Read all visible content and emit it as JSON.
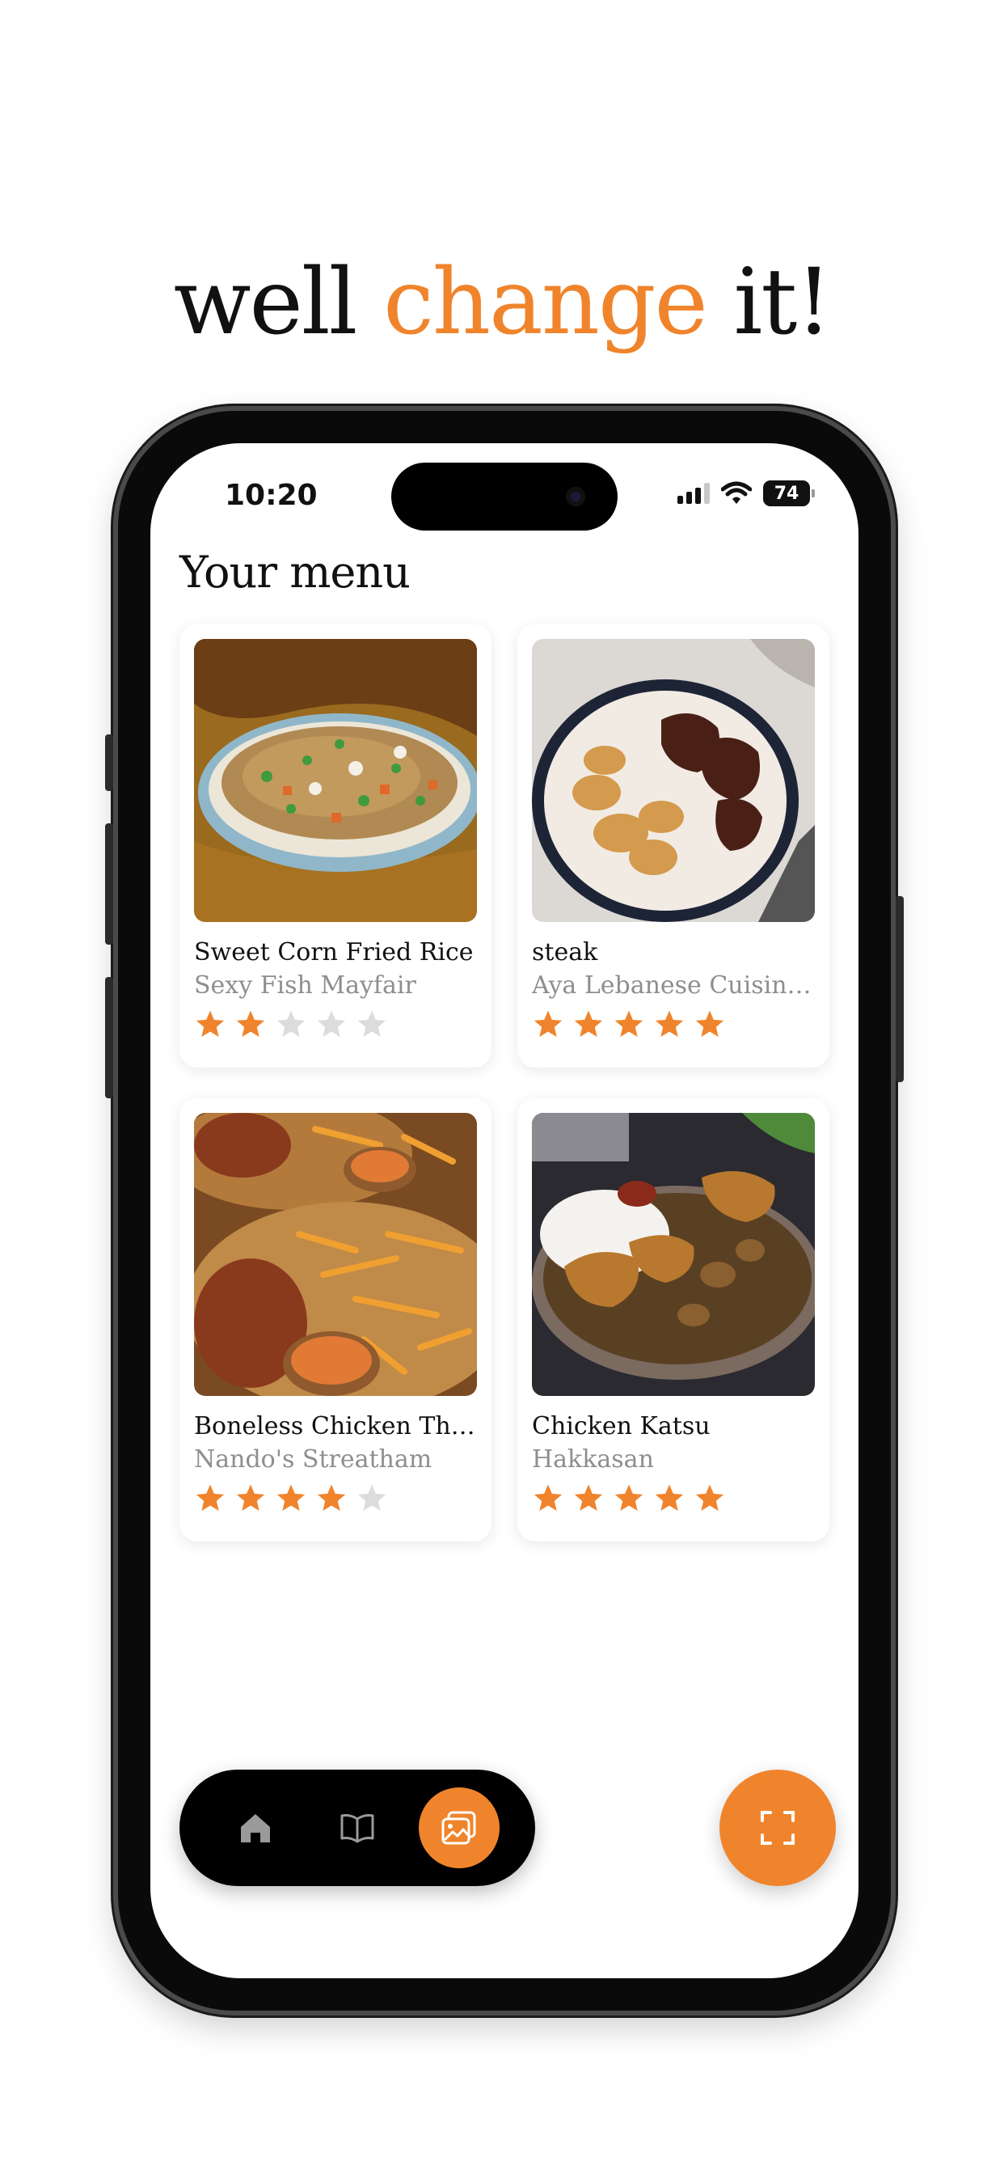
{
  "headline": {
    "part1": "well",
    "accent": "change",
    "part2": "it!"
  },
  "status_bar": {
    "time": "10:20",
    "battery": "74"
  },
  "page_title": "Your menu",
  "menu_items": [
    {
      "name": "Sweet Corn Fried Rice",
      "venue": "Sexy Fish Mayfair",
      "rating": 2,
      "max_rating": 5
    },
    {
      "name": "steak",
      "venue": "Aya Lebanese Cuisine...",
      "rating": 5,
      "max_rating": 5
    },
    {
      "name": "Boneless Chicken Thi...",
      "venue": "Nando's Streatham",
      "rating": 4,
      "max_rating": 5
    },
    {
      "name": "Chicken Katsu",
      "venue": "Hakkasan",
      "rating": 5,
      "max_rating": 5
    }
  ],
  "nav": {
    "items": [
      {
        "icon": "home-icon"
      },
      {
        "icon": "book-icon"
      },
      {
        "icon": "gallery-icon",
        "active": true
      }
    ]
  },
  "fab": {
    "icon": "scan-icon"
  },
  "colors": {
    "accent": "#f0842c",
    "star_empty": "#dcdcdc"
  }
}
